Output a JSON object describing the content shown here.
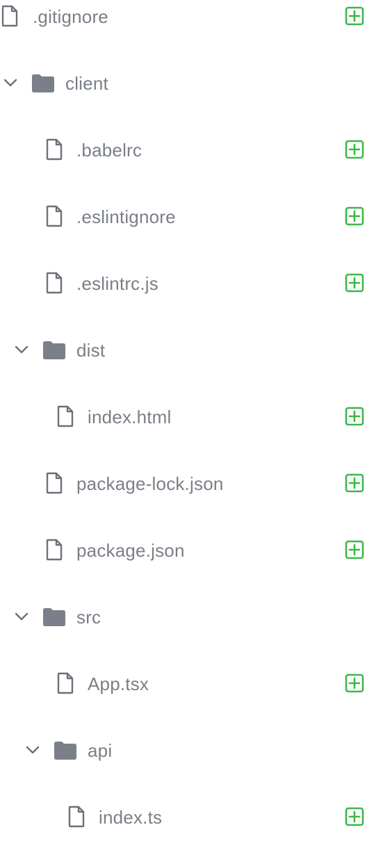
{
  "tree": {
    "items": [
      {
        "type": "file",
        "name": ".gitignore",
        "level": 0,
        "addable": true
      },
      {
        "type": "folder",
        "name": "client",
        "level": 0,
        "expanded": true
      },
      {
        "type": "file",
        "name": ".babelrc",
        "level": 1,
        "addable": true
      },
      {
        "type": "file",
        "name": ".eslintignore",
        "level": 1,
        "addable": true
      },
      {
        "type": "file",
        "name": ".eslintrc.js",
        "level": 1,
        "addable": true
      },
      {
        "type": "folder",
        "name": "dist",
        "level": 1,
        "expanded": true
      },
      {
        "type": "file",
        "name": "index.html",
        "level": 2,
        "addable": true
      },
      {
        "type": "file",
        "name": "package-lock.json",
        "level": 1,
        "addable": true
      },
      {
        "type": "file",
        "name": "package.json",
        "level": 1,
        "addable": true
      },
      {
        "type": "folder",
        "name": "src",
        "level": 1,
        "expanded": true
      },
      {
        "type": "file",
        "name": "App.tsx",
        "level": 2,
        "addable": true
      },
      {
        "type": "folder",
        "name": "api",
        "level": 2,
        "expanded": true
      },
      {
        "type": "file",
        "name": "index.ts",
        "level": 3,
        "addable": true
      }
    ]
  },
  "icons": {
    "file": "file-icon",
    "folder": "folder-icon",
    "chevron": "chevron-down-icon",
    "add": "add-file-icon"
  },
  "colors": {
    "label": "#7a7f87",
    "icon": "#6b7079",
    "folder": "#7a7f89",
    "add": "#3cb84a"
  }
}
